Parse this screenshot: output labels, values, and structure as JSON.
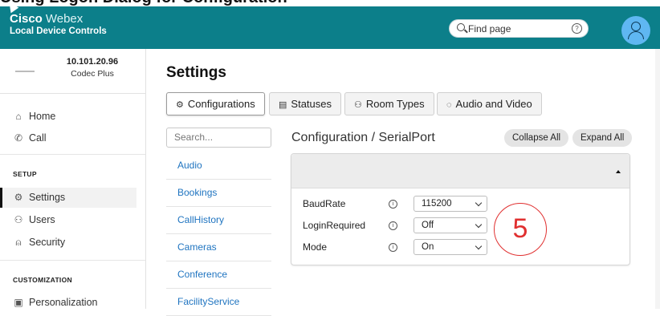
{
  "caption": "Using Logon Dialog for Configuration",
  "header": {
    "brand_strong": "Cisco",
    "brand_light": "Webex",
    "subtitle": "Local Device Controls",
    "find_placeholder": "Find page",
    "help_glyph": "?"
  },
  "device": {
    "ip": "10.101.20.96",
    "model": "Codec Plus"
  },
  "sidebar": {
    "nav": [
      {
        "label": "Home",
        "icon": "home-icon",
        "glyph": "⌂"
      },
      {
        "label": "Call",
        "icon": "phone-icon",
        "glyph": "✆"
      }
    ],
    "setup_title": "SETUP",
    "setup": [
      {
        "label": "Settings",
        "icon": "gear-icon",
        "glyph": "⚙",
        "active": true
      },
      {
        "label": "Users",
        "icon": "user-icon",
        "glyph": "⚇"
      },
      {
        "label": "Security",
        "icon": "lock-icon",
        "glyph": "⍝"
      }
    ],
    "custom_title": "CUSTOMIZATION",
    "custom": [
      {
        "label": "Personalization",
        "icon": "image-icon",
        "glyph": "▣"
      }
    ]
  },
  "main": {
    "title": "Settings",
    "tabs": [
      {
        "label": "Configurations",
        "icon": "gear-icon",
        "glyph": "⚙",
        "active": true
      },
      {
        "label": "Statuses",
        "icon": "document-icon",
        "glyph": "▤"
      },
      {
        "label": "Room Types",
        "icon": "people-icon",
        "glyph": "⚇"
      },
      {
        "label": "Audio and Video",
        "icon": "media-icon",
        "glyph": "◌"
      }
    ],
    "search_placeholder": "Search...",
    "categories": [
      "Audio",
      "Bookings",
      "CallHistory",
      "Cameras",
      "Conference",
      "FacilityService"
    ],
    "breadcrumb": "Configuration / SerialPort",
    "collapse_label": "Collapse All",
    "expand_label": "Expand All",
    "settings": [
      {
        "label": "BaudRate",
        "value": "115200"
      },
      {
        "label": "LoginRequired",
        "value": "Off"
      },
      {
        "label": "Mode",
        "value": "On"
      }
    ],
    "info_glyph": "i"
  },
  "annotation": "5",
  "colors": {
    "header": "#0c7f8a",
    "link": "#1f74c0",
    "callout": "#e03030",
    "avatar": "#5fb7f2"
  }
}
